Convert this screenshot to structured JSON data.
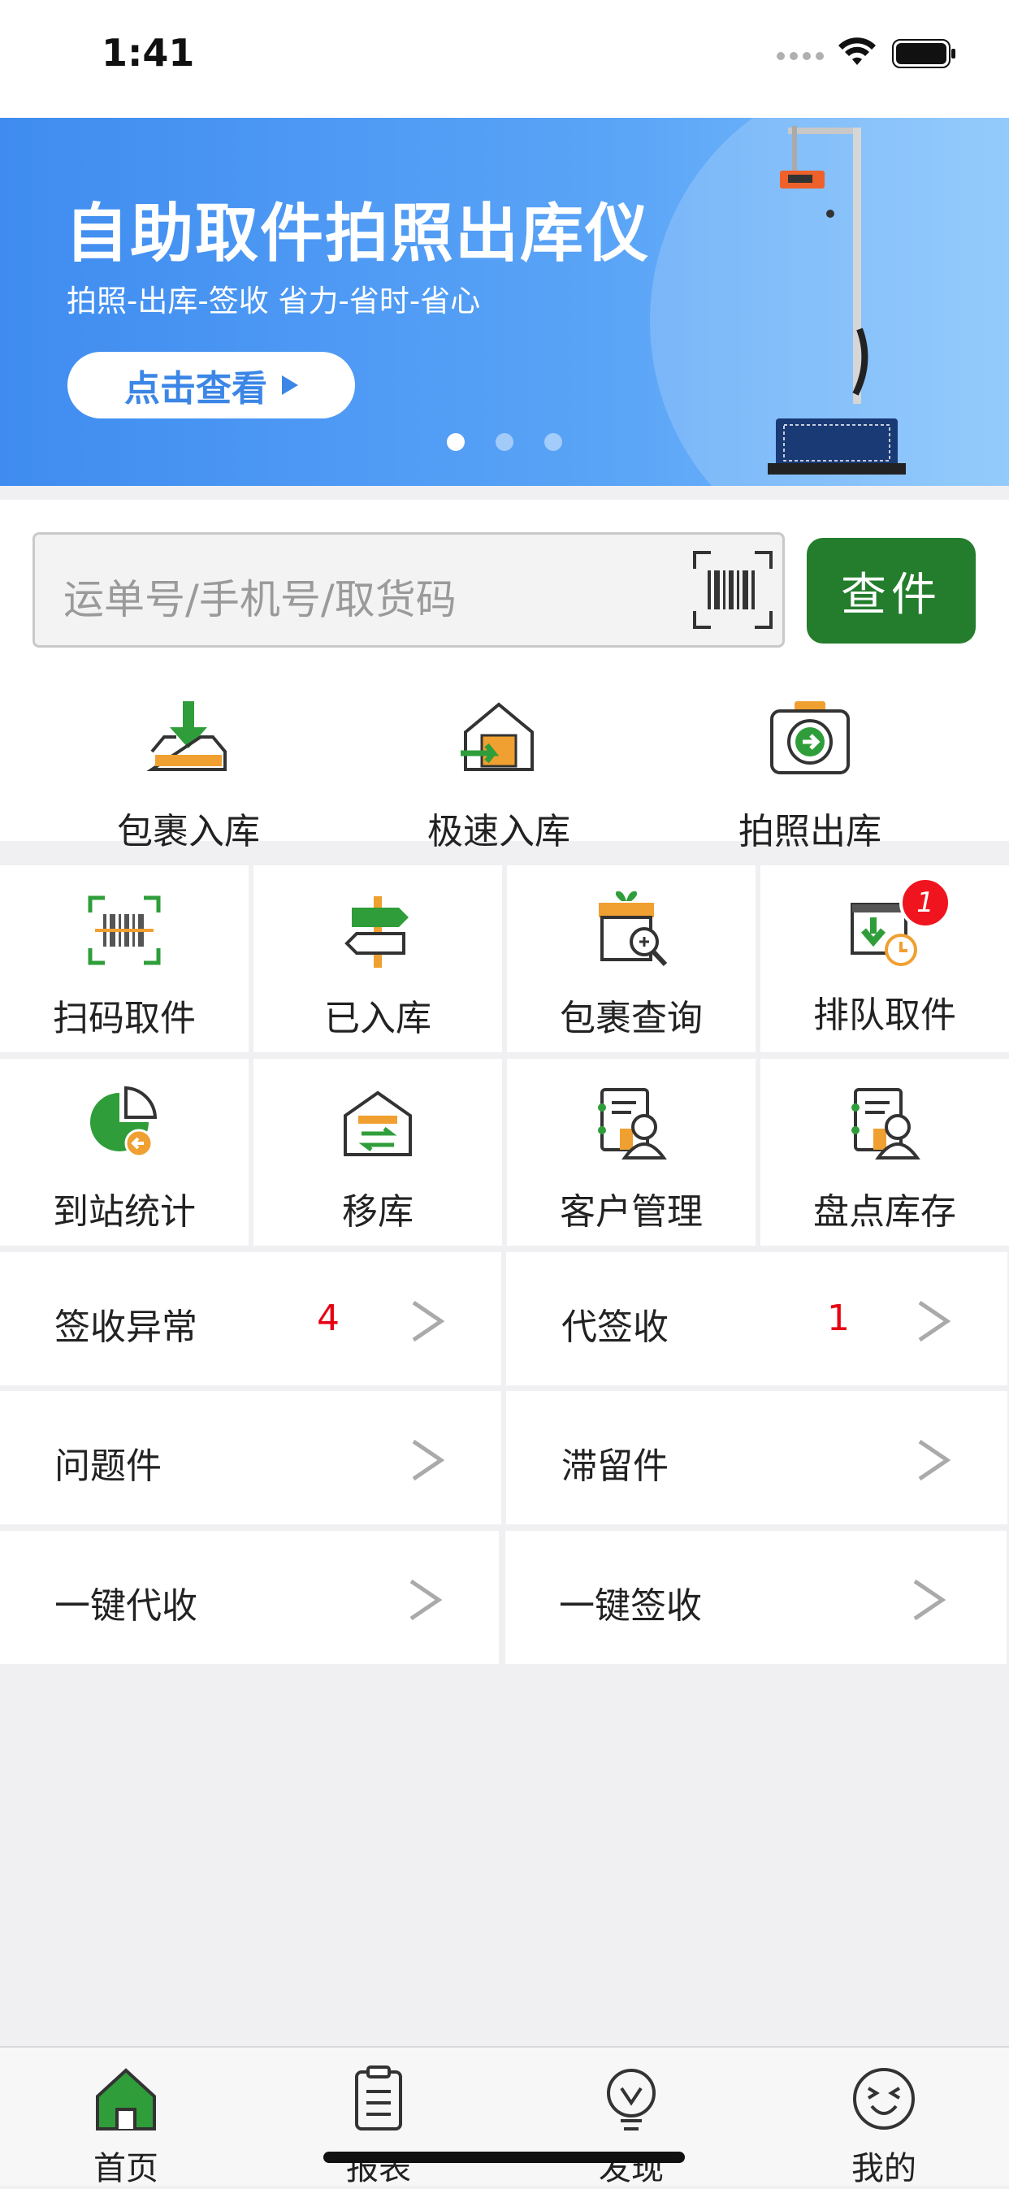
{
  "status_bar": {
    "time": "1:41"
  },
  "banner": {
    "title": "自助取件拍照出库仪",
    "subtitle": "拍照-出库-签收   省力-省时-省心",
    "cta_label": "点击查看"
  },
  "search": {
    "placeholder": "运单号/手机号/取货码",
    "button_label": "查件"
  },
  "quick_actions": [
    {
      "label": "包裹入库",
      "icon": "inbox-download-icon"
    },
    {
      "label": "极速入库",
      "icon": "fast-warehouse-icon"
    },
    {
      "label": "拍照出库",
      "icon": "camera-out-icon"
    }
  ],
  "grid": [
    {
      "label": "扫码取件",
      "icon": "barcode-scan-icon"
    },
    {
      "label": "已入库",
      "icon": "signpost-icon"
    },
    {
      "label": "包裹查询",
      "icon": "package-search-icon"
    },
    {
      "label": "排队取件",
      "icon": "queue-pickup-icon",
      "badge": "1"
    },
    {
      "label": "到站统计",
      "icon": "pie-chart-icon"
    },
    {
      "label": "移库",
      "icon": "warehouse-transfer-icon"
    },
    {
      "label": "客户管理",
      "icon": "customer-icon"
    },
    {
      "label": "盘点库存",
      "icon": "inventory-icon"
    }
  ],
  "list": [
    {
      "label": "签收异常",
      "count": "4"
    },
    {
      "label": "代签收",
      "count": "1"
    },
    {
      "label": "问题件",
      "count": ""
    },
    {
      "label": "滞留件",
      "count": ""
    },
    {
      "label": "一键代收",
      "count": ""
    },
    {
      "label": "一键签收",
      "count": ""
    }
  ],
  "tabs": [
    {
      "label": "首页",
      "icon": "home-icon",
      "active": true
    },
    {
      "label": "报表",
      "icon": "clipboard-icon"
    },
    {
      "label": "发现",
      "icon": "lightbulb-icon"
    },
    {
      "label": "我的",
      "icon": "smiley-icon"
    }
  ],
  "colors": {
    "accent_green": "#237d2c",
    "badge_red": "#f0141e",
    "banner_blue": "#4a96f3"
  }
}
